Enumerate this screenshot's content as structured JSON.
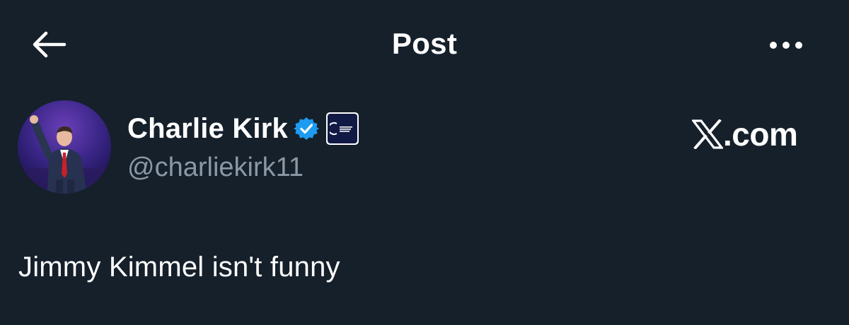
{
  "header": {
    "back_icon": "arrow-left-icon",
    "title": "Post",
    "more_icon": "more-horizontal-icon"
  },
  "author": {
    "display_name": "Charlie Kirk",
    "handle": "@charliekirk11",
    "verified_icon": "verified-badge-icon",
    "affiliate_icon": "organization-logo-icon"
  },
  "watermark": {
    "logo_icon": "x-logo-icon",
    "suffix": ".com"
  },
  "tweet": {
    "text": "Jimmy Kimmel isn't funny"
  },
  "colors": {
    "background": "#15202b",
    "text": "#ffffff",
    "secondary_text": "#8b98a5",
    "verified_blue": "#1d9bf0"
  }
}
